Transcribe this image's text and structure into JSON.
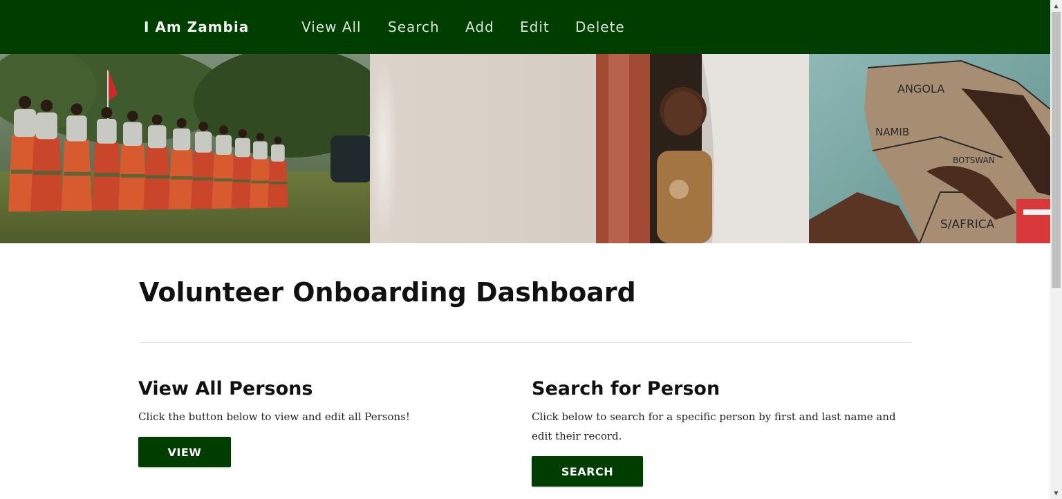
{
  "nav": {
    "brand": "I Am Zambia",
    "links": [
      "View All",
      "Search",
      "Add",
      "Edit",
      "Delete"
    ],
    "background": "#003e00"
  },
  "hero": {
    "panels": [
      "group-dancers-photo",
      "child-in-doorway-photo",
      "hands-on-africa-map-photo"
    ],
    "map_labels": [
      "ANGOLA",
      "NAMIB",
      "BOTSWAN",
      "S/AFRICA"
    ]
  },
  "main": {
    "title": "Volunteer Onboarding Dashboard",
    "cards": [
      {
        "title": "View All Persons",
        "text": "Click the button below to view and edit all Persons!",
        "button": "VIEW"
      },
      {
        "title": "Search for Person",
        "text": "Click below to search for a specific person by first and last name and edit their record.",
        "button": "SEARCH"
      }
    ]
  },
  "colors": {
    "accent": "#003e00",
    "text": "#111111"
  },
  "scrollbar": {
    "up_arrow": "▲",
    "down_arrow": "▼"
  }
}
